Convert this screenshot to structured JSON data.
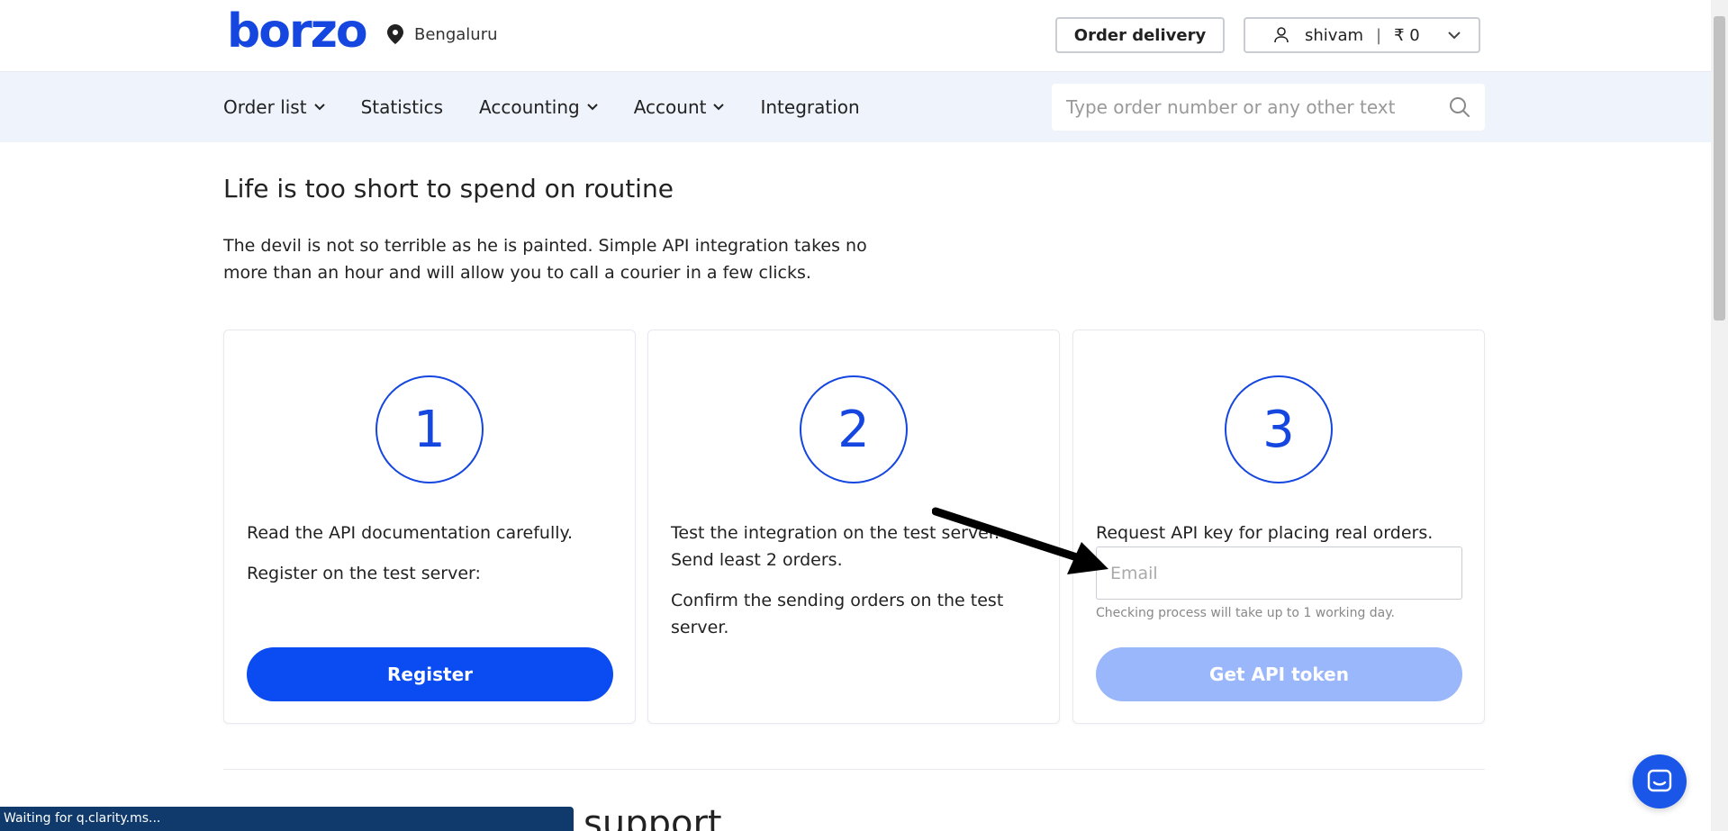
{
  "header": {
    "logo": "borzo",
    "city": "Bengaluru",
    "order_button": "Order delivery",
    "user_name": "shivam",
    "balance": "₹ 0"
  },
  "nav": {
    "items": [
      {
        "label": "Order list",
        "has_dropdown": true
      },
      {
        "label": "Statistics",
        "has_dropdown": false
      },
      {
        "label": "Accounting",
        "has_dropdown": true
      },
      {
        "label": "Account",
        "has_dropdown": true
      },
      {
        "label": "Integration",
        "has_dropdown": false
      }
    ],
    "search_placeholder": "Type order number or any other text"
  },
  "hero": {
    "title": "Life is too short to spend on routine",
    "description": "The devil is not so terrible as he is painted. Simple API integration takes no more than an hour and will allow you to call a courier in a few clicks."
  },
  "steps": [
    {
      "number": "1",
      "lines": [
        "Read the API documentation carefully.",
        "Register on the test server:"
      ],
      "button": "Register"
    },
    {
      "number": "2",
      "lines": [
        "Test the integration on the test server. Send least 2 orders.",
        "Confirm the sending orders on the test server."
      ]
    },
    {
      "number": "3",
      "lines": [
        "Request API key for placing real orders."
      ],
      "email_placeholder": "Email",
      "email_value": "",
      "hint": "Checking process will take up to 1 working day.",
      "button": "Get API token"
    }
  ],
  "support": {
    "partial_title": "support"
  },
  "status_bar": "Waiting for q.clarity.ms...",
  "colors": {
    "brand": "#1546e0",
    "primary_button": "#0a4cf2",
    "disabled_button": "#9ab7fb",
    "nav_bg": "#eef3fc"
  },
  "icons": [
    "map-pin-icon",
    "user-icon",
    "chevron-down-icon",
    "search-icon",
    "chat-icon"
  ]
}
